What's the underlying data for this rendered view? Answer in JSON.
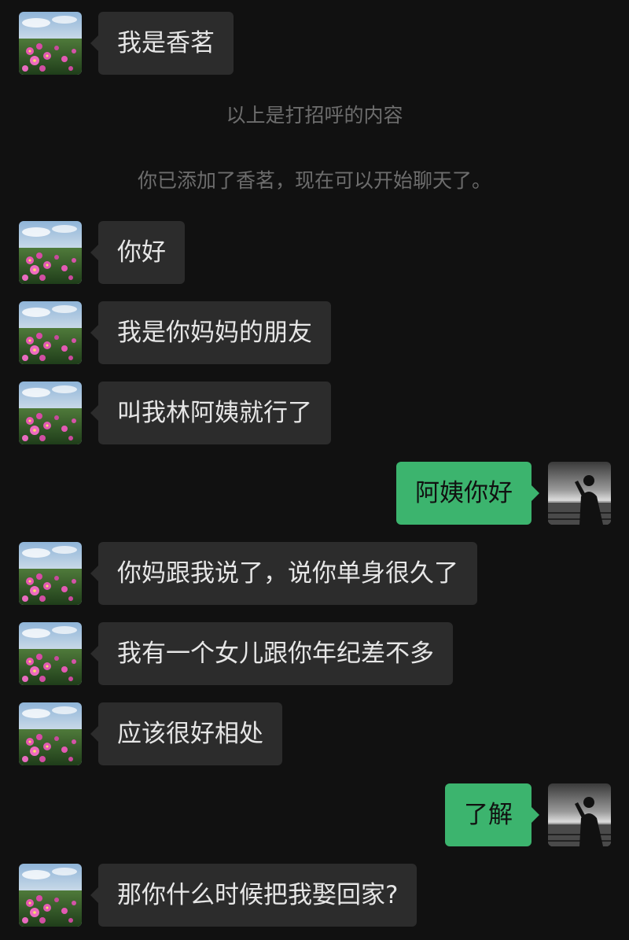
{
  "contact": {
    "name": "香茗",
    "avatar_icon": "flower-field-avatar-icon"
  },
  "me": {
    "avatar_icon": "silhouette-sea-avatar-icon"
  },
  "colors": {
    "background": "#111111",
    "incoming_bubble": "#2c2c2c",
    "outgoing_bubble": "#3cb46e",
    "system_text": "#6d6d6d"
  },
  "messages": [
    {
      "type": "incoming",
      "text": "我是香茗"
    },
    {
      "type": "system",
      "text": "以上是打招呼的内容"
    },
    {
      "type": "system",
      "text": "你已添加了香茗，现在可以开始聊天了。"
    },
    {
      "type": "incoming",
      "text": "你好"
    },
    {
      "type": "incoming",
      "text": "我是你妈妈的朋友"
    },
    {
      "type": "incoming",
      "text": "叫我林阿姨就行了"
    },
    {
      "type": "outgoing",
      "text": "阿姨你好"
    },
    {
      "type": "incoming",
      "text": "你妈跟我说了，说你单身很久了"
    },
    {
      "type": "incoming",
      "text": "我有一个女儿跟你年纪差不多"
    },
    {
      "type": "incoming",
      "text": "应该很好相处"
    },
    {
      "type": "outgoing",
      "text": "了解"
    },
    {
      "type": "incoming",
      "text": "那你什么时候把我娶回家?"
    }
  ]
}
